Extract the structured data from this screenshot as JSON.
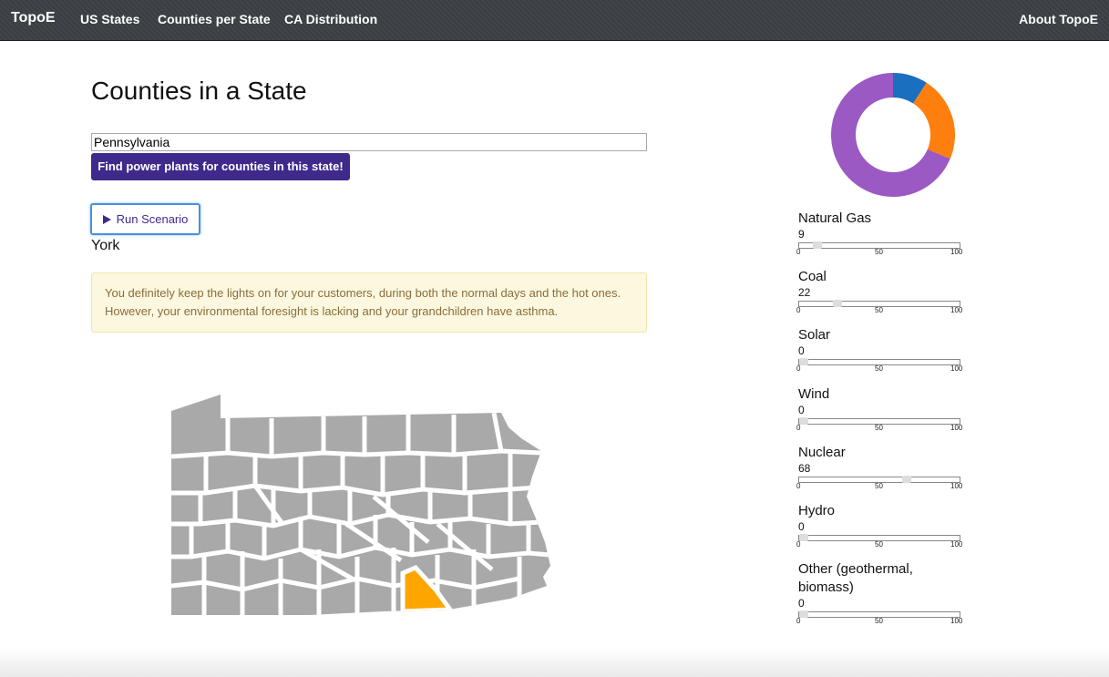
{
  "nav": {
    "brand": "TopoE",
    "links": [
      "US States",
      "Counties per State",
      "CA Distribution"
    ],
    "about": "About TopoE"
  },
  "page_title": "Counties in a State",
  "state_input": {
    "value": "Pennsylvania",
    "placeholder": ""
  },
  "find_button_label": "Find power plants for counties in this state!",
  "run_button_label": "Run Scenario",
  "selected_county": "York",
  "alert_text": "You definitely keep the lights on for your customers, during both the normal days and the hot ones. However, your environmental foresight is lacking and your grandchildren have asthma.",
  "colors": {
    "primary": "#3f2a8c",
    "county_fill": "#a9a9a9",
    "highlight_county": "#ffa500",
    "natural_gas": "#1a6fbf",
    "coal": "#ff7f0e",
    "nuclear": "#9b59c4"
  },
  "sliders": [
    {
      "label": "Natural Gas",
      "value": "9",
      "level": 9
    },
    {
      "label": "Coal",
      "value": "22",
      "level": 22
    },
    {
      "label": "Solar",
      "value": "0",
      "level": 0
    },
    {
      "label": "Wind",
      "value": "0",
      "level": 0
    },
    {
      "label": "Nuclear",
      "value": "68",
      "level": 68
    },
    {
      "label": "Hydro",
      "value": "0",
      "level": 0
    },
    {
      "label": "Other (geothermal, biomass)",
      "value": "0",
      "level": 0
    }
  ],
  "tick_labels": [
    "0",
    "50",
    "100"
  ]
}
